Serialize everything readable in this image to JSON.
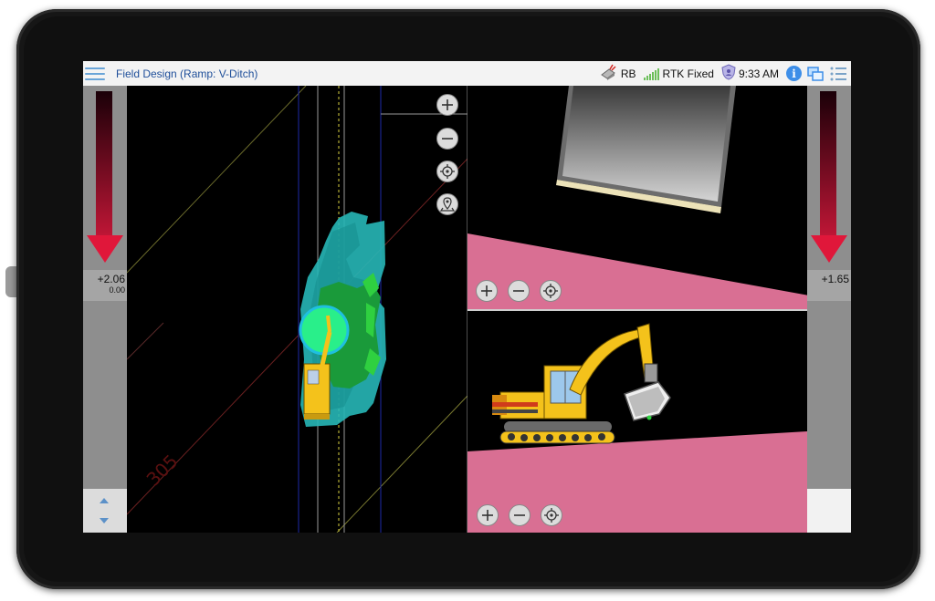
{
  "app": {
    "title": "Field Design (Ramp: V-Ditch)"
  },
  "status": {
    "base_label": "RB",
    "gps_label": "RTK Fixed",
    "time": "9:33 AM"
  },
  "left_rail": {
    "primary_value": "+2.06",
    "secondary_value": "0.00"
  },
  "right_rail": {
    "primary_value": "+1.65"
  },
  "plan_view": {
    "grid_label": "305"
  },
  "colors": {
    "title_blue": "#1f4f9a",
    "cut_arrow": "#e0173a",
    "design_surface": "#d96f93",
    "coverage": "#27b7b7",
    "machine": "#f4c21b"
  },
  "icons": {
    "menu": "hamburger-icon",
    "base": "base-station-icon",
    "gps": "signal-bars-icon",
    "shield": "user-shield-icon",
    "info": "info-icon",
    "windows": "windows-icon",
    "list": "list-icon"
  }
}
